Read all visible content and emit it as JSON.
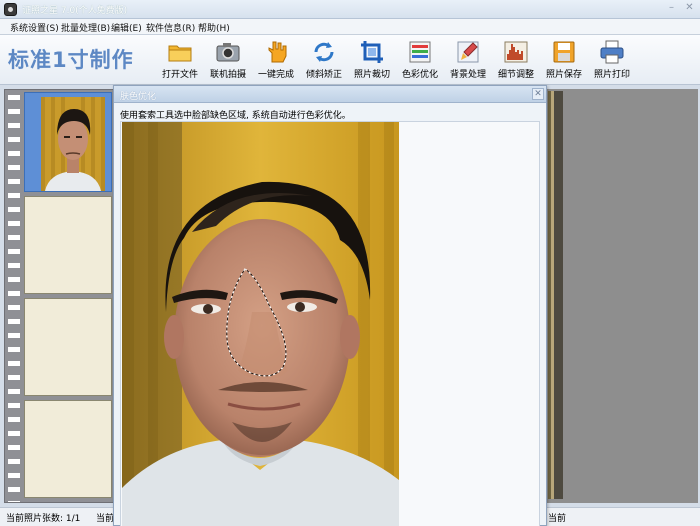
{
  "window": {
    "title": "证照之星 7.0(个人免费版)",
    "minimize": "–",
    "close": "✕"
  },
  "menu": [
    {
      "label": "系统设置(S)"
    },
    {
      "label": "批量处理(B)"
    },
    {
      "label": "编辑(E)"
    },
    {
      "label": "软件信息(R)"
    },
    {
      "label": "帮助(H)"
    }
  ],
  "toolbar": {
    "brand": "标准1寸制作",
    "tools": [
      {
        "label": "打开文件",
        "icon": "folder-icon"
      },
      {
        "label": "联机拍摄",
        "icon": "camera-icon"
      },
      {
        "label": "一键完成",
        "icon": "hand-icon"
      },
      {
        "label": "倾斜矫正",
        "icon": "rotate-icon"
      },
      {
        "label": "照片裁切",
        "icon": "crop-icon"
      },
      {
        "label": "色彩优化",
        "icon": "color-bars-icon"
      },
      {
        "label": "背景处理",
        "icon": "paint-brush-icon"
      },
      {
        "label": "细节调整",
        "icon": "histogram-icon"
      },
      {
        "label": "照片保存",
        "icon": "save-icon"
      },
      {
        "label": "照片打印",
        "icon": "printer-icon"
      }
    ]
  },
  "dialog": {
    "title": "肤色优化",
    "close": "✕",
    "hint": "使用套索工具选中脸部缺色区域, 系统自动进行色彩优化。"
  },
  "status": {
    "count": "当前照片张数: 1/1",
    "current": "当前"
  },
  "colors": {
    "brand": "#5d88c4",
    "film_selected": "#5e8fd6",
    "photo_background": "#d7a82b"
  }
}
